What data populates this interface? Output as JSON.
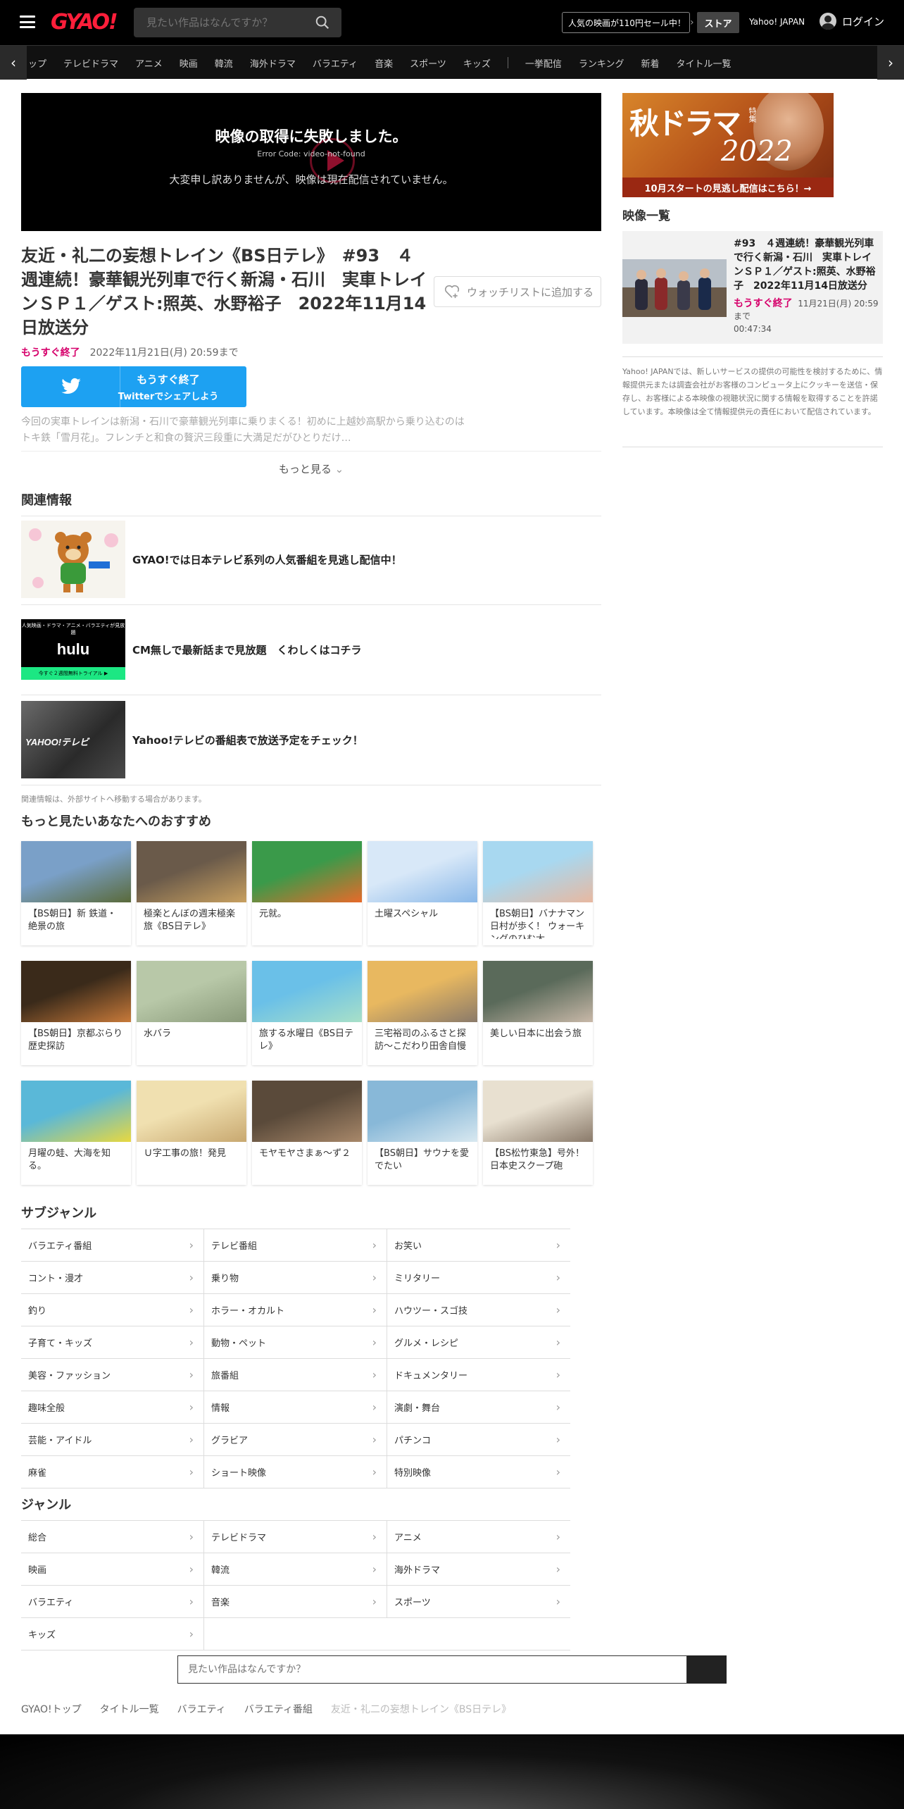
{
  "header": {
    "logo": "GYAO!",
    "search_placeholder": "見たい作品はなんですか？",
    "promo": "人気の映画が110円セール中！",
    "store": "ストア",
    "yahoo": "Yahoo! JAPAN",
    "login": "ログイン"
  },
  "nav": {
    "items": [
      "ップ",
      "テレビドラマ",
      "アニメ",
      "映画",
      "韓流",
      "海外ドラマ",
      "バラエティ",
      "音楽",
      "スポーツ",
      "キッズ"
    ],
    "items2": [
      "一挙配信",
      "ランキング",
      "新着",
      "タイトル一覧"
    ]
  },
  "player": {
    "error_title": "映像の取得に失敗しました。",
    "error_code": "Error Code: video-not-found",
    "error_msg": "大変申し訳ありませんが、映像は現在配信されていません。"
  },
  "episode": {
    "title": "友近・礼二の妄想トレイン《BS日テレ》　#93　４週連続！豪華観光列車で行く新潟・石川　実車トレインＳＰ１／ゲスト:照英、水野裕子　2022年11月14日放送分",
    "watchlist": "ウォッチリストに追加する",
    "ending": "もうすぐ終了",
    "until": "2022年11月21日(月) 20:59まで",
    "twitter_l1": "もうすぐ終了",
    "twitter_l2": "Twitterでシェアしよう",
    "description": "今回の実車トレインは新潟・石川で豪華観光列車に乗りまくる！初めに上越妙高駅から乗り込むのはトキ鉄「雪月花」。フレンチと和食の贅沢三段重に大満足だがひとりだけ…",
    "more": "もっと見る"
  },
  "related": {
    "heading": "関連情報",
    "items": [
      {
        "text": "GYAO!では日本テレビ系列の人気番組を見逃し配信中！"
      },
      {
        "text": "CM無しで最新話まで見放題　くわしくはコチラ"
      },
      {
        "text": "Yahoo!テレビの番組表で放送予定をチェック！"
      }
    ],
    "hulu_top": "人気映画・ドラマ・アニメ・バラエティが見放題",
    "hulu_logo": "hulu",
    "hulu_bottom": "今すぐ２週間無料トライアル ▶",
    "ytv_logo": "YAHOO!テレビ",
    "note": "関連情報は、外部サイトへ移動する場合があります。"
  },
  "recommend": {
    "heading": "もっと見たいあなたへのおすすめ",
    "items": [
      {
        "label": "【BS朝日】新 鉄道・絶景の旅",
        "c1": "#7aa0c8",
        "c2": "#5a6a3a"
      },
      {
        "label": "極楽とんぼの週末極楽旅《BS日テレ》",
        "c1": "#6a5a4a",
        "c2": "#c8a060"
      },
      {
        "label": "元就。",
        "c1": "#3a9a4a",
        "c2": "#e86a2a"
      },
      {
        "label": "土曜スペシャル",
        "c1": "#d8e8f8",
        "c2": "#8ab8e8"
      },
      {
        "label": "【BS朝日】バナナマン日村が歩く！ ウォーキングのひむ太",
        "c1": "#a8d8f0",
        "c2": "#e8b8a0"
      },
      {
        "label": "【BS朝日】京都ぶらり歴史探訪",
        "c1": "#3a2a1a",
        "c2": "#c87a3a"
      },
      {
        "label": "水バラ",
        "c1": "#b8c8a8",
        "c2": "#8a9a7a"
      },
      {
        "label": "旅する水曜日《BS日テレ》",
        "c1": "#6ac0e8",
        "c2": "#a8e0c8"
      },
      {
        "label": "三宅裕司のふるさと探訪～こだわり田舎自慢",
        "c1": "#e8b860",
        "c2": "#8a7a6a"
      },
      {
        "label": "美しい日本に出会う旅",
        "c1": "#5a6a5a",
        "c2": "#c8b8a8"
      },
      {
        "label": "月曜の蛙、大海を知る。",
        "c1": "#5ab8d8",
        "c2": "#e8d840"
      },
      {
        "label": "Ｕ字工事の旅！発見",
        "c1": "#f0e0b0",
        "c2": "#c8a870"
      },
      {
        "label": "モヤモヤさまぁ～ず２",
        "c1": "#5a4a3a",
        "c2": "#a8886a"
      },
      {
        "label": "【BS朝日】サウナを愛でたい",
        "c1": "#88b8d8",
        "c2": "#d8e8f0"
      },
      {
        "label": "【BS松竹東急】号外！日本史スクープ砲",
        "c1": "#e8e0d0",
        "c2": "#8a7a6a"
      }
    ]
  },
  "subgenre": {
    "heading": "サブジャンル",
    "items": [
      "バラエティ番組",
      "テレビ番組",
      "お笑い",
      "コント・漫才",
      "乗り物",
      "ミリタリー",
      "釣り",
      "ホラー・オカルト",
      "ハウツー・スゴ技",
      "子育て・キッズ",
      "動物・ペット",
      "グルメ・レシピ",
      "美容・ファッション",
      "旅番組",
      "ドキュメンタリー",
      "趣味全般",
      "情報",
      "演劇・舞台",
      "芸能・アイドル",
      "グラビア",
      "パチンコ",
      "麻雀",
      "ショート映像",
      "特別映像"
    ]
  },
  "genre": {
    "heading": "ジャンル",
    "items": [
      "総合",
      "テレビドラマ",
      "アニメ",
      "映画",
      "韓流",
      "海外ドラマ",
      "バラエティ",
      "音楽",
      "スポーツ",
      "キッズ"
    ]
  },
  "bottom_search": {
    "placeholder": "見たい作品はなんですか？"
  },
  "breadcrumb": [
    "GYAO!トップ",
    "タイトル一覧",
    "バラエティ",
    "バラエティ番組",
    "友近・礼二の妄想トレイン《BS日テレ》"
  ],
  "sidebar": {
    "banner_t1": "秋ドラマ",
    "banner_t2": "2022",
    "banner_special": "特集",
    "banner_cta": "10月スタートの見逃し配信はこちら！→",
    "list_heading": "映像一覧",
    "card_title": "#93　４週連続！豪華観光列車で行く新潟・石川　実車トレインＳＰ１／ゲスト:照英、水野裕子　2022年11月14日放送分",
    "card_ending": "もうすぐ終了",
    "card_until": "11月21日(月) 20:59まで",
    "card_duration": "00:47:34",
    "note": "Yahoo! JAPANでは、新しいサービスの提供の可能性を検討するために、情報提供元または調査会社がお客様のコンピュータ上にクッキーを送信・保存し、お客様による本映像の視聴状況に関する情報を取得することを許諾しています。本映像は全て情報提供元の責任において配信されています。"
  },
  "colors": {
    "brand": "#ff1e3a",
    "ending": "#d6006b",
    "twitter": "#1da1f2"
  }
}
